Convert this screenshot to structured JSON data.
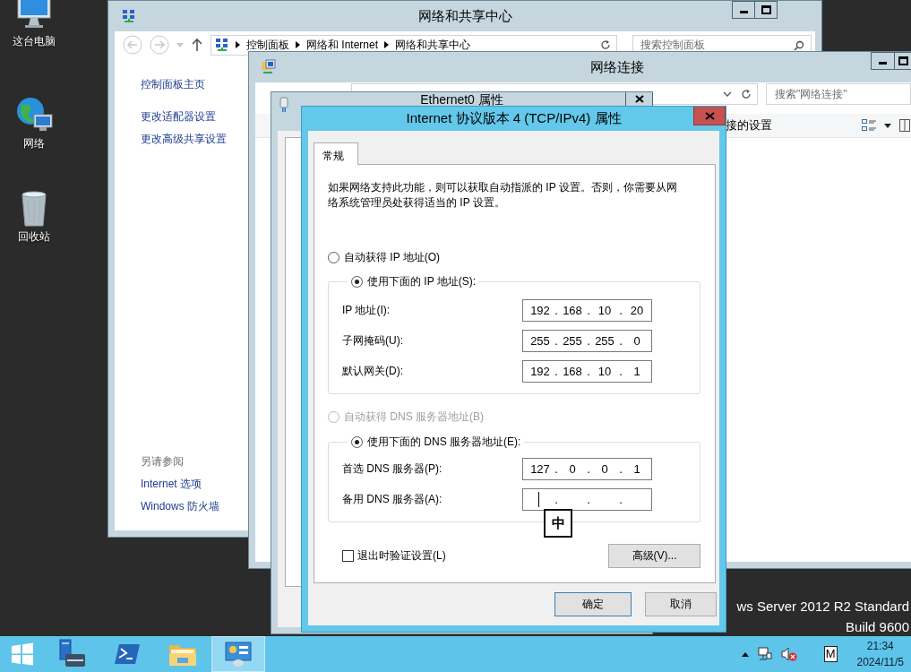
{
  "desktop": {
    "icons": [
      {
        "label": "这台电脑",
        "kind": "computer"
      },
      {
        "label": "网络",
        "kind": "network"
      },
      {
        "label": "回收站",
        "kind": "recycle-bin"
      }
    ],
    "edition_lines": [
      "ws Server 2012 R2 Standard",
      "Build 9600"
    ]
  },
  "sharing_center_window": {
    "title": "网络和共享中心",
    "breadcrumbs": [
      "控制面板",
      "网络和 Internet",
      "网络和共享中心"
    ],
    "search": {
      "placeholder": "搜索控制面板"
    },
    "tasks": [
      "控制面板主页",
      "更改适配器设置",
      "更改高级共享设置"
    ],
    "see_also": {
      "heading": "另请参阅",
      "links": [
        "Internet 选项",
        "Windows 防火墙"
      ]
    }
  },
  "network_connections_window": {
    "title": "网络连接",
    "search": {
      "placeholder": "搜索\"网络连接\""
    },
    "toolbar_text": "接的设置"
  },
  "ethernet_properties_window": {
    "title": "Ethernet0 属性"
  },
  "ipv4_dialog": {
    "title": "Internet 协议版本 4 (TCP/IPv4) 属性",
    "tabs": [
      {
        "label": "常规",
        "selected": true
      }
    ],
    "description": "如果网络支持此功能，则可以获取自动指派的 IP 设置。否则，你需要从网络系统管理员处获得适当的 IP 设置。",
    "separator": ".",
    "ip_options": [
      {
        "label": "自动获得 IP 地址(O)",
        "selected": false,
        "disabled": false
      },
      {
        "label": "使用下面的 IP 地址(S):",
        "selected": true,
        "disabled": false
      }
    ],
    "ip_fields": [
      {
        "label": "IP 地址(I):",
        "octets": [
          "192",
          "168",
          "10",
          "20"
        ],
        "focused": false
      },
      {
        "label": "子网掩码(U):",
        "octets": [
          "255",
          "255",
          "255",
          "0"
        ],
        "focused": false
      },
      {
        "label": "默认网关(D):",
        "octets": [
          "192",
          "168",
          "10",
          "1"
        ],
        "focused": false
      }
    ],
    "dns_options": [
      {
        "label": "自动获得 DNS 服务器地址(B)",
        "selected": false,
        "disabled": true
      },
      {
        "label": "使用下面的 DNS 服务器地址(E):",
        "selected": true,
        "disabled": false
      }
    ],
    "dns_fields": [
      {
        "label": "首选 DNS 服务器(P):",
        "octets": [
          "127",
          "0",
          "0",
          "1"
        ],
        "focused": false
      },
      {
        "label": "备用 DNS 服务器(A):",
        "focused": true
      }
    ],
    "validate_on_exit": {
      "label": "退出时验证设置(L)",
      "checked": false
    },
    "advanced_button": "高级(V)...",
    "buttons": [
      {
        "label": "确定",
        "default": true
      },
      {
        "label": "取消",
        "default": false
      }
    ],
    "ime_indicator": "中"
  },
  "taskbar": {
    "apps": [
      {
        "kind": "server-manager",
        "selected": false
      },
      {
        "kind": "powershell",
        "selected": false
      },
      {
        "kind": "file-explorer",
        "selected": false
      },
      {
        "kind": "network-panel",
        "selected": true
      }
    ],
    "ime": "M",
    "time": "21:34",
    "date": "2024/11/5"
  }
}
